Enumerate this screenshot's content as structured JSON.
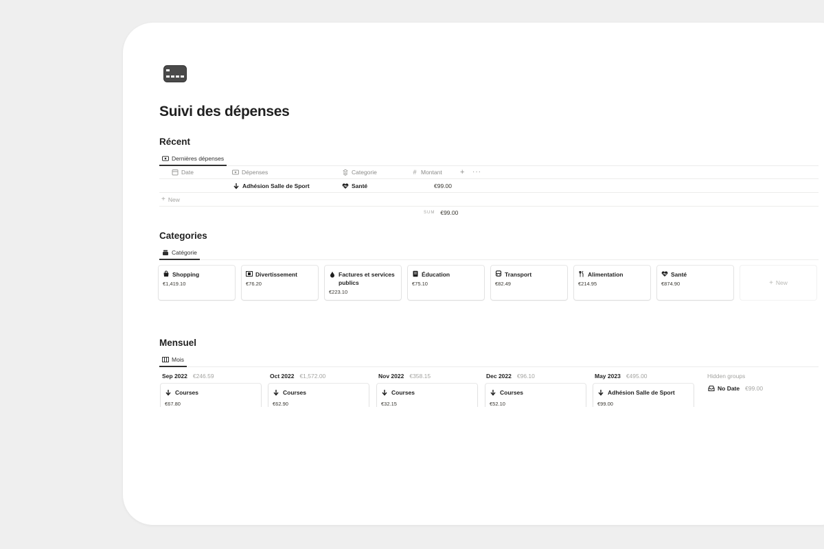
{
  "page": {
    "title": "Suivi des dépenses",
    "icon": "credit-card-icon"
  },
  "recent": {
    "title": "Récent",
    "view_tab": "Dernières dépenses",
    "columns": {
      "date": "Date",
      "depenses": "Dépenses",
      "categorie": "Categorie",
      "montant": "Montant"
    },
    "rows": [
      {
        "date": "",
        "depense": "Adhésion Salle de Sport",
        "categorie": "Santé",
        "montant": "€99.00"
      }
    ],
    "new_label": "New",
    "sum_label": "SUM",
    "sum_value": "€99.00"
  },
  "categories": {
    "title": "Categories",
    "view_tab": "Catégorie",
    "cards": [
      {
        "name": "Shopping",
        "value": "€1,419.10",
        "icon": "shopping-bag-icon"
      },
      {
        "name": "Divertissement",
        "value": "€76.20",
        "icon": "film-icon"
      },
      {
        "name": "Factures et services publics",
        "value": "€223.10",
        "icon": "drop-icon"
      },
      {
        "name": "Éducation",
        "value": "€75.10",
        "icon": "book-icon"
      },
      {
        "name": "Transport",
        "value": "€82.49",
        "icon": "bus-icon"
      },
      {
        "name": "Alimentation",
        "value": "€214.95",
        "icon": "fork-knife-icon"
      },
      {
        "name": "Santé",
        "value": "€874.90",
        "icon": "heart-pulse-icon"
      }
    ],
    "new_label": "New"
  },
  "monthly": {
    "title": "Mensuel",
    "view_tab": "Mois",
    "columns": [
      {
        "label": "Sep 2022",
        "amount": "€246.59",
        "card": {
          "name": "Courses",
          "value": "€67.80"
        }
      },
      {
        "label": "Oct 2022",
        "amount": "€1,572.00",
        "card": {
          "name": "Courses",
          "value": "€62.90"
        }
      },
      {
        "label": "Nov 2022",
        "amount": "€358.15",
        "card": {
          "name": "Courses",
          "value": "€32.15"
        }
      },
      {
        "label": "Dec 2022",
        "amount": "€96.10",
        "card": {
          "name": "Courses",
          "value": "€52.10"
        }
      },
      {
        "label": "May 2023",
        "amount": "€495.00",
        "card": {
          "name": "Adhésion Salle de Sport",
          "value": "€99.00"
        }
      }
    ],
    "hidden_groups_label": "Hidden groups",
    "hidden_group": {
      "label": "No Date",
      "amount": "€99.00"
    }
  },
  "colors": {
    "background": "#efefef",
    "card": "#ffffff",
    "text": "#37352f",
    "muted": "#a3a3a0"
  }
}
